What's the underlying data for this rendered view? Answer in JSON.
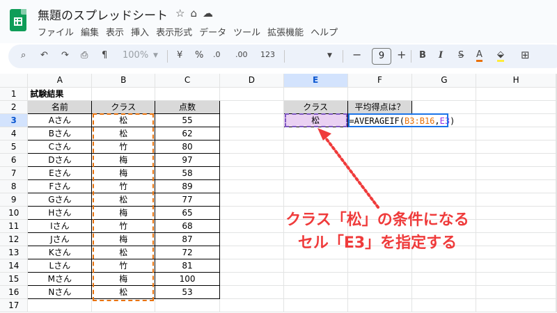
{
  "window": {
    "doc_title": "無題のスプレッドシート",
    "title_icons": [
      "star-icon",
      "move-to-folder-icon",
      "cloud-status-icon"
    ]
  },
  "menu": [
    "ファイル",
    "編集",
    "表示",
    "挿入",
    "表示形式",
    "データ",
    "ツール",
    "拡張機能",
    "ヘルプ"
  ],
  "toolbar": {
    "zoom": "100%",
    "currency": "¥",
    "percent": "%",
    "decimal_decrease": ".0",
    "decimal_increase": ".00",
    "number_format": "123",
    "font_size": "9",
    "bold": "B",
    "italic": "I",
    "strike": "S",
    "text_color": "A",
    "icons": [
      "search-icon",
      "undo-icon",
      "redo-icon",
      "print-icon",
      "paint-format-icon",
      "font-dropdown-icon",
      "minus-icon",
      "plus-icon",
      "fill-color-icon",
      "borders-icon"
    ]
  },
  "columns": [
    "A",
    "B",
    "C",
    "D",
    "E",
    "F",
    "G",
    "H"
  ],
  "rows": [
    "1",
    "2",
    "3",
    "4",
    "5",
    "6",
    "7",
    "8",
    "9",
    "10",
    "11",
    "12",
    "13",
    "14",
    "15",
    "16",
    "17"
  ],
  "sheet": {
    "title": "試験結果",
    "headers": {
      "name": "名前",
      "class": "クラス",
      "score": "点数"
    },
    "records": [
      {
        "name": "Aさん",
        "class": "松",
        "score": "55"
      },
      {
        "name": "Bさん",
        "class": "松",
        "score": "62"
      },
      {
        "name": "Cさん",
        "class": "竹",
        "score": "80"
      },
      {
        "name": "Dさん",
        "class": "梅",
        "score": "97"
      },
      {
        "name": "Eさん",
        "class": "梅",
        "score": "58"
      },
      {
        "name": "Fさん",
        "class": "竹",
        "score": "89"
      },
      {
        "name": "Gさん",
        "class": "松",
        "score": "77"
      },
      {
        "name": "Hさん",
        "class": "梅",
        "score": "65"
      },
      {
        "name": "Iさん",
        "class": "竹",
        "score": "68"
      },
      {
        "name": "Jさん",
        "class": "梅",
        "score": "87"
      },
      {
        "name": "Kさん",
        "class": "松",
        "score": "72"
      },
      {
        "name": "Lさん",
        "class": "竹",
        "score": "81"
      },
      {
        "name": "Mさん",
        "class": "梅",
        "score": "100"
      },
      {
        "name": "Nさん",
        "class": "松",
        "score": "53"
      }
    ],
    "lookup": {
      "class_header": "クラス",
      "avg_header": "平均得点は？",
      "class_value": "松",
      "formula_prefix": "=AVERAGEIF(",
      "formula_range": "B3:B16",
      "formula_comma": ",",
      "formula_ref": "E3",
      "formula_suffix": ")"
    }
  },
  "annotation": {
    "line1": "クラス「松」の条件になる",
    "line2": "セル「E3」を指定する",
    "color": "#ef3b3b"
  },
  "colors": {
    "range_highlight": "#e8710a",
    "ref_highlight": "#9334e6",
    "active_border": "#1a73e8",
    "header_fill": "#d9d9d9"
  }
}
